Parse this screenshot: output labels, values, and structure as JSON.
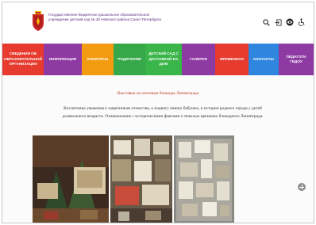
{
  "header": {
    "org_name": "Государственное бюджетное дошкольное образовательное учреждение детский сад № 28 Невского района Санкт-Петербурга"
  },
  "tools": [
    {
      "name": "search-icon"
    },
    {
      "name": "login-icon"
    },
    {
      "name": "vision-impaired-icon"
    },
    {
      "name": "accessibility-icon"
    }
  ],
  "nav": {
    "items": [
      {
        "label": "СВЕДЕНИЯ ОБ ОБРАЗОВАТЕЛЬНОЙ ОРГАНИЗАЦИИ",
        "color": "#e63b2e"
      },
      {
        "label": "ИНФОРМАЦИЯ",
        "color": "#8e3aa3"
      },
      {
        "label": "КОНКУРСЫ",
        "color": "#f39c12"
      },
      {
        "label": "РОДИТЕЛЯМ",
        "color": "#37a84a"
      },
      {
        "label": "ДЕТСКИЙ САД С ДОСТАВКОЙ НА ДОМ",
        "color": "#3ab54a"
      },
      {
        "label": "ГАЛЕРЕЯ",
        "color": "#8e3aa3"
      },
      {
        "label": "ВРЕМЕННАЯ",
        "color": "#e63b2e"
      },
      {
        "label": "КОНТАКТЫ",
        "color": "#2e86de"
      },
      {
        "label": "ПЕДАГОГИ ГБДОУ",
        "color": "#8e3aa3"
      }
    ]
  },
  "article": {
    "title": "Выставка по мотивам блокады Ленинграда",
    "text": "Воспитание уважения к защитникам отечества, к подвигу наших бабушек, к истории родного города у детей дошкольного возраста. Ознакомление с историческими фактами о тяжелых временах блокадного Ленинграда."
  }
}
